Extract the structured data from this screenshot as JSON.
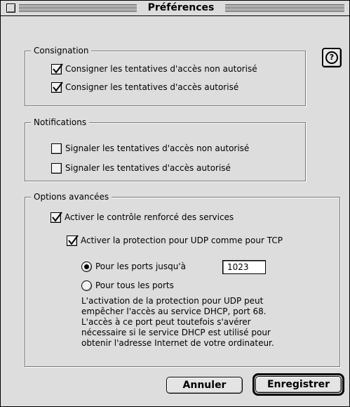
{
  "window": {
    "title": "Préférences"
  },
  "help": {
    "icon": "question-mark-icon",
    "glyph": "?"
  },
  "consignation": {
    "label": "Consignation",
    "items": [
      {
        "label": "Consigner les tentatives d'accès non autorisé",
        "checked": true
      },
      {
        "label": "Consigner les tentatives d'accès autorisé",
        "checked": true
      }
    ]
  },
  "notifications": {
    "label": "Notifications",
    "items": [
      {
        "label": "Signaler les tentatives d'accès non autorisé",
        "checked": false
      },
      {
        "label": "Signaler les tentatives d'accès autorisé",
        "checked": false
      }
    ]
  },
  "options": {
    "label": "Options avancées",
    "enhanced_services": {
      "label": "Activer le contrôle renforcé des services",
      "checked": true
    },
    "udp_protection": {
      "label": "Activer la protection pour UDP comme pour TCP",
      "checked": true
    },
    "ports_upto": {
      "label": "Pour les ports jusqu'à",
      "selected": true,
      "value": "1023"
    },
    "all_ports": {
      "label": "Pour tous les ports",
      "selected": false
    },
    "note": "L'activation de la protection pour UDP peut empêcher l'accès au service DHCP, port 68. L'accès à ce port peut toutefois s'avérer nécessaire si le service DHCP est utilisé pour obtenir l'adresse Internet de votre ordinateur."
  },
  "buttons": {
    "cancel": "Annuler",
    "save": "Enregistrer"
  }
}
